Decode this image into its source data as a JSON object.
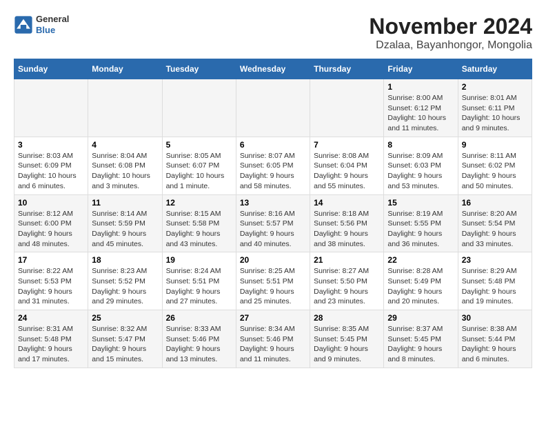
{
  "header": {
    "logo_general": "General",
    "logo_blue": "Blue",
    "title": "November 2024",
    "subtitle": "Dzalaa, Bayanhongor, Mongolia"
  },
  "days_of_week": [
    "Sunday",
    "Monday",
    "Tuesday",
    "Wednesday",
    "Thursday",
    "Friday",
    "Saturday"
  ],
  "weeks": [
    [
      {
        "day": "",
        "info": ""
      },
      {
        "day": "",
        "info": ""
      },
      {
        "day": "",
        "info": ""
      },
      {
        "day": "",
        "info": ""
      },
      {
        "day": "",
        "info": ""
      },
      {
        "day": "1",
        "info": "Sunrise: 8:00 AM\nSunset: 6:12 PM\nDaylight: 10 hours and 11 minutes."
      },
      {
        "day": "2",
        "info": "Sunrise: 8:01 AM\nSunset: 6:11 PM\nDaylight: 10 hours and 9 minutes."
      }
    ],
    [
      {
        "day": "3",
        "info": "Sunrise: 8:03 AM\nSunset: 6:09 PM\nDaylight: 10 hours and 6 minutes."
      },
      {
        "day": "4",
        "info": "Sunrise: 8:04 AM\nSunset: 6:08 PM\nDaylight: 10 hours and 3 minutes."
      },
      {
        "day": "5",
        "info": "Sunrise: 8:05 AM\nSunset: 6:07 PM\nDaylight: 10 hours and 1 minute."
      },
      {
        "day": "6",
        "info": "Sunrise: 8:07 AM\nSunset: 6:05 PM\nDaylight: 9 hours and 58 minutes."
      },
      {
        "day": "7",
        "info": "Sunrise: 8:08 AM\nSunset: 6:04 PM\nDaylight: 9 hours and 55 minutes."
      },
      {
        "day": "8",
        "info": "Sunrise: 8:09 AM\nSunset: 6:03 PM\nDaylight: 9 hours and 53 minutes."
      },
      {
        "day": "9",
        "info": "Sunrise: 8:11 AM\nSunset: 6:02 PM\nDaylight: 9 hours and 50 minutes."
      }
    ],
    [
      {
        "day": "10",
        "info": "Sunrise: 8:12 AM\nSunset: 6:00 PM\nDaylight: 9 hours and 48 minutes."
      },
      {
        "day": "11",
        "info": "Sunrise: 8:14 AM\nSunset: 5:59 PM\nDaylight: 9 hours and 45 minutes."
      },
      {
        "day": "12",
        "info": "Sunrise: 8:15 AM\nSunset: 5:58 PM\nDaylight: 9 hours and 43 minutes."
      },
      {
        "day": "13",
        "info": "Sunrise: 8:16 AM\nSunset: 5:57 PM\nDaylight: 9 hours and 40 minutes."
      },
      {
        "day": "14",
        "info": "Sunrise: 8:18 AM\nSunset: 5:56 PM\nDaylight: 9 hours and 38 minutes."
      },
      {
        "day": "15",
        "info": "Sunrise: 8:19 AM\nSunset: 5:55 PM\nDaylight: 9 hours and 36 minutes."
      },
      {
        "day": "16",
        "info": "Sunrise: 8:20 AM\nSunset: 5:54 PM\nDaylight: 9 hours and 33 minutes."
      }
    ],
    [
      {
        "day": "17",
        "info": "Sunrise: 8:22 AM\nSunset: 5:53 PM\nDaylight: 9 hours and 31 minutes."
      },
      {
        "day": "18",
        "info": "Sunrise: 8:23 AM\nSunset: 5:52 PM\nDaylight: 9 hours and 29 minutes."
      },
      {
        "day": "19",
        "info": "Sunrise: 8:24 AM\nSunset: 5:51 PM\nDaylight: 9 hours and 27 minutes."
      },
      {
        "day": "20",
        "info": "Sunrise: 8:25 AM\nSunset: 5:51 PM\nDaylight: 9 hours and 25 minutes."
      },
      {
        "day": "21",
        "info": "Sunrise: 8:27 AM\nSunset: 5:50 PM\nDaylight: 9 hours and 23 minutes."
      },
      {
        "day": "22",
        "info": "Sunrise: 8:28 AM\nSunset: 5:49 PM\nDaylight: 9 hours and 20 minutes."
      },
      {
        "day": "23",
        "info": "Sunrise: 8:29 AM\nSunset: 5:48 PM\nDaylight: 9 hours and 19 minutes."
      }
    ],
    [
      {
        "day": "24",
        "info": "Sunrise: 8:31 AM\nSunset: 5:48 PM\nDaylight: 9 hours and 17 minutes."
      },
      {
        "day": "25",
        "info": "Sunrise: 8:32 AM\nSunset: 5:47 PM\nDaylight: 9 hours and 15 minutes."
      },
      {
        "day": "26",
        "info": "Sunrise: 8:33 AM\nSunset: 5:46 PM\nDaylight: 9 hours and 13 minutes."
      },
      {
        "day": "27",
        "info": "Sunrise: 8:34 AM\nSunset: 5:46 PM\nDaylight: 9 hours and 11 minutes."
      },
      {
        "day": "28",
        "info": "Sunrise: 8:35 AM\nSunset: 5:45 PM\nDaylight: 9 hours and 9 minutes."
      },
      {
        "day": "29",
        "info": "Sunrise: 8:37 AM\nSunset: 5:45 PM\nDaylight: 9 hours and 8 minutes."
      },
      {
        "day": "30",
        "info": "Sunrise: 8:38 AM\nSunset: 5:44 PM\nDaylight: 9 hours and 6 minutes."
      }
    ]
  ]
}
